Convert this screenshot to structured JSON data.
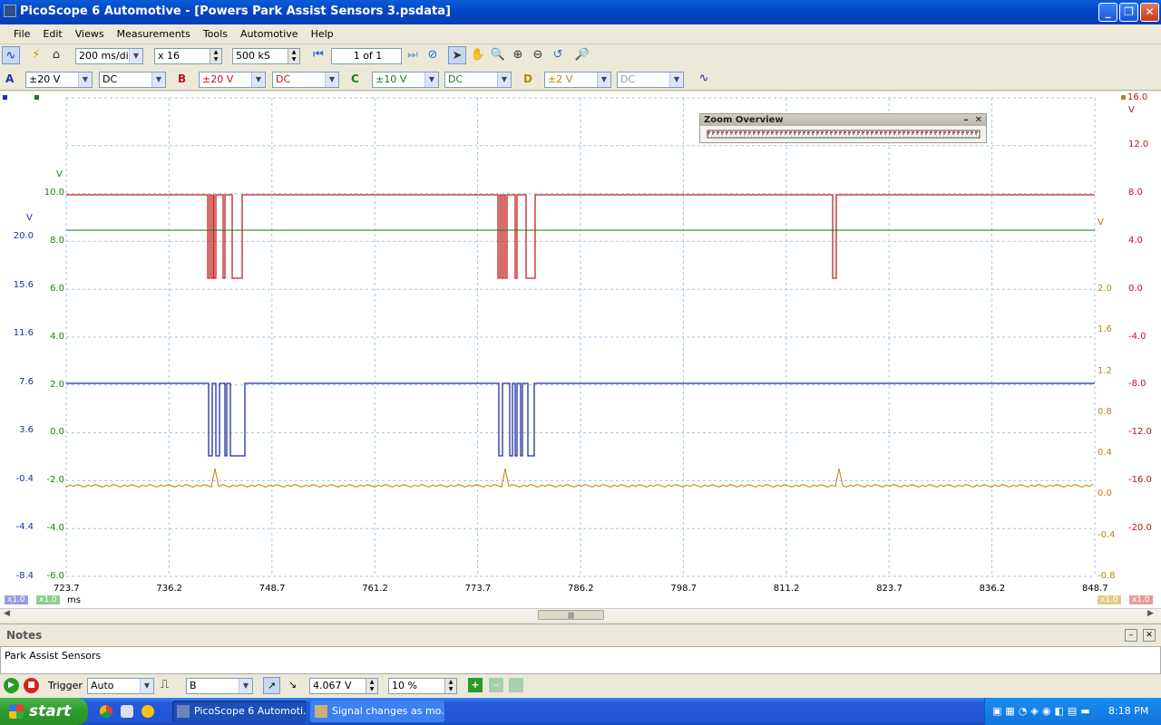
{
  "window": {
    "title": "PicoScope 6 Automotive - [Powers Park Assist Sensors 3.psdata]"
  },
  "menu": [
    "File",
    "Edit",
    "Views",
    "Measurements",
    "Tools",
    "Automotive",
    "Help"
  ],
  "toolbar": {
    "timebase": "200 ms/div",
    "zoom": "x 16",
    "samples": "500 kS",
    "page": "1 of 1"
  },
  "channels": [
    {
      "letter": "A",
      "range": "±20 V",
      "coupling": "DC",
      "color": "#1f2fa3"
    },
    {
      "letter": "B",
      "range": "±20 V",
      "coupling": "DC",
      "color": "#b01a1a"
    },
    {
      "letter": "C",
      "range": "±10 V",
      "coupling": "DC",
      "color": "#1a7a1a"
    },
    {
      "letter": "D",
      "range": "±2 V",
      "coupling": "DC",
      "color": "#b08a10"
    }
  ],
  "axes": {
    "time_labels": [
      "723.7",
      "736.2",
      "748.7",
      "761.2",
      "773.7",
      "786.2",
      "798.7",
      "811.2",
      "823.7",
      "836.2",
      "848.7"
    ],
    "time_unit": "ms",
    "a_unit": "V",
    "a_labels": [
      "20.0",
      "15.6",
      "11.6",
      "7.6",
      "3.6",
      "-0.4",
      "-4.4",
      "-8.4"
    ],
    "c_unit": "V",
    "c_labels": [
      "10.0",
      "8.0",
      "6.0",
      "4.0",
      "2.0",
      "0.0",
      "-2.0",
      "-4.0",
      "-6.0"
    ],
    "d_unit": "V",
    "d_labels": [
      "2.0",
      "1.6",
      "1.2",
      "0.8",
      "0.4",
      "0.0",
      "-0.4",
      "-0.8"
    ],
    "b_top": "16.0",
    "b_unit": "V",
    "b_labels": [
      "12.0",
      "8.0",
      "4.0",
      "0.0",
      "-4.0",
      "-8.0",
      "-12.0",
      "-16.0",
      "-20.0"
    ],
    "scale_labels": [
      "x1.0",
      "x1.0",
      "x1.0",
      "x1.0"
    ]
  },
  "zoom_overview": {
    "title": "Zoom Overview"
  },
  "notes": {
    "title": "Notes",
    "text": "Park Assist Sensors"
  },
  "trigger": {
    "label": "Trigger",
    "mode": "Auto",
    "source": "B",
    "level": "4.067 V",
    "pretrigger": "10 %"
  },
  "taskbar": {
    "start": "start",
    "items": [
      "PicoScope 6 Automoti...",
      "Signal changes as mo..."
    ],
    "clock": "8:18 PM"
  }
}
